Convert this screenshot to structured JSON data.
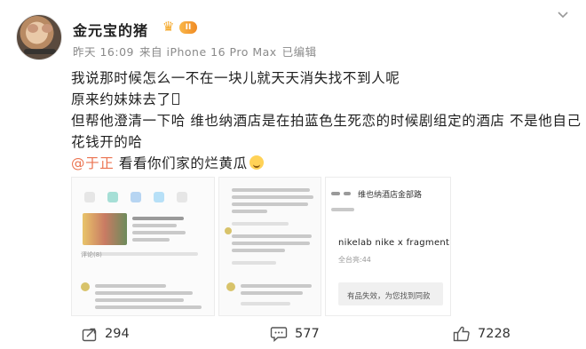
{
  "author": {
    "name": "金元宝的猪",
    "level_badge": "II",
    "time": "昨天 16:09",
    "source": "来自 iPhone 16 Pro Max",
    "edited": "已编辑"
  },
  "post": {
    "line1": "我说那时候怎么一不在一块儿就天天消失找不到人呢",
    "line2": "原来约妹妹去了",
    "line3": "但帮他澄清一下哈 维也纳酒店是在拍蓝色生死恋的时候剧组定的酒店 不是他自己",
    "line4": "花钱开的哈",
    "mention": "@于正",
    "line5_rest": "看看你们家的烂黄瓜"
  },
  "images": {
    "img1_comment_label": "评论(8)",
    "img3_title": "维也纳酒店金部路",
    "img3_brand": "nikelab nike x fragment air z",
    "img3_sub": "全台亮:44",
    "img3_box": "有品失效，为您找到同款"
  },
  "actions": {
    "repost_count": "294",
    "comment_count": "577",
    "like_count": "7228"
  },
  "colors": {
    "mention": "#eb7350",
    "badge": "#f08a24"
  },
  "icons": {
    "more": "chevron-down-icon",
    "repost": "share-icon",
    "comment": "comment-icon",
    "like": "thumbs-up-icon"
  }
}
